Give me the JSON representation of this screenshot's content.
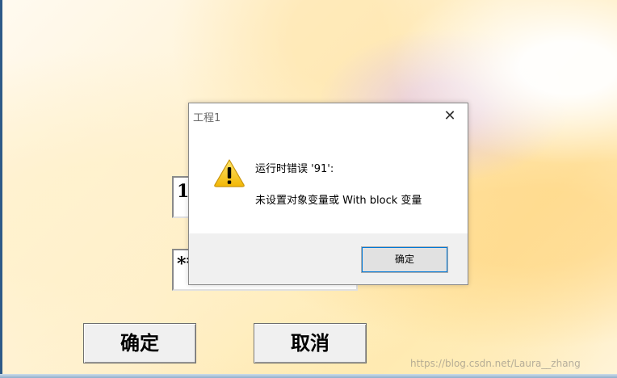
{
  "form": {
    "textbox1_value": "1",
    "textbox2_value": "**",
    "ok_button_label": "确定",
    "cancel_button_label": "取消"
  },
  "dialog": {
    "title": "工程1",
    "close_glyph": "✕",
    "icon": "warning-icon",
    "message_line1": "运行时错误 '91':",
    "message_line2": "未设置对象变量或 With block 变量",
    "ok_button_label": "确定"
  },
  "watermark": {
    "text": "https://blog.csdn.net/Laura__zhang"
  },
  "colors": {
    "warning_yellow": "#f6c928",
    "dialog_footer": "#f0f0f0",
    "focus_blue": "#0078d7"
  }
}
